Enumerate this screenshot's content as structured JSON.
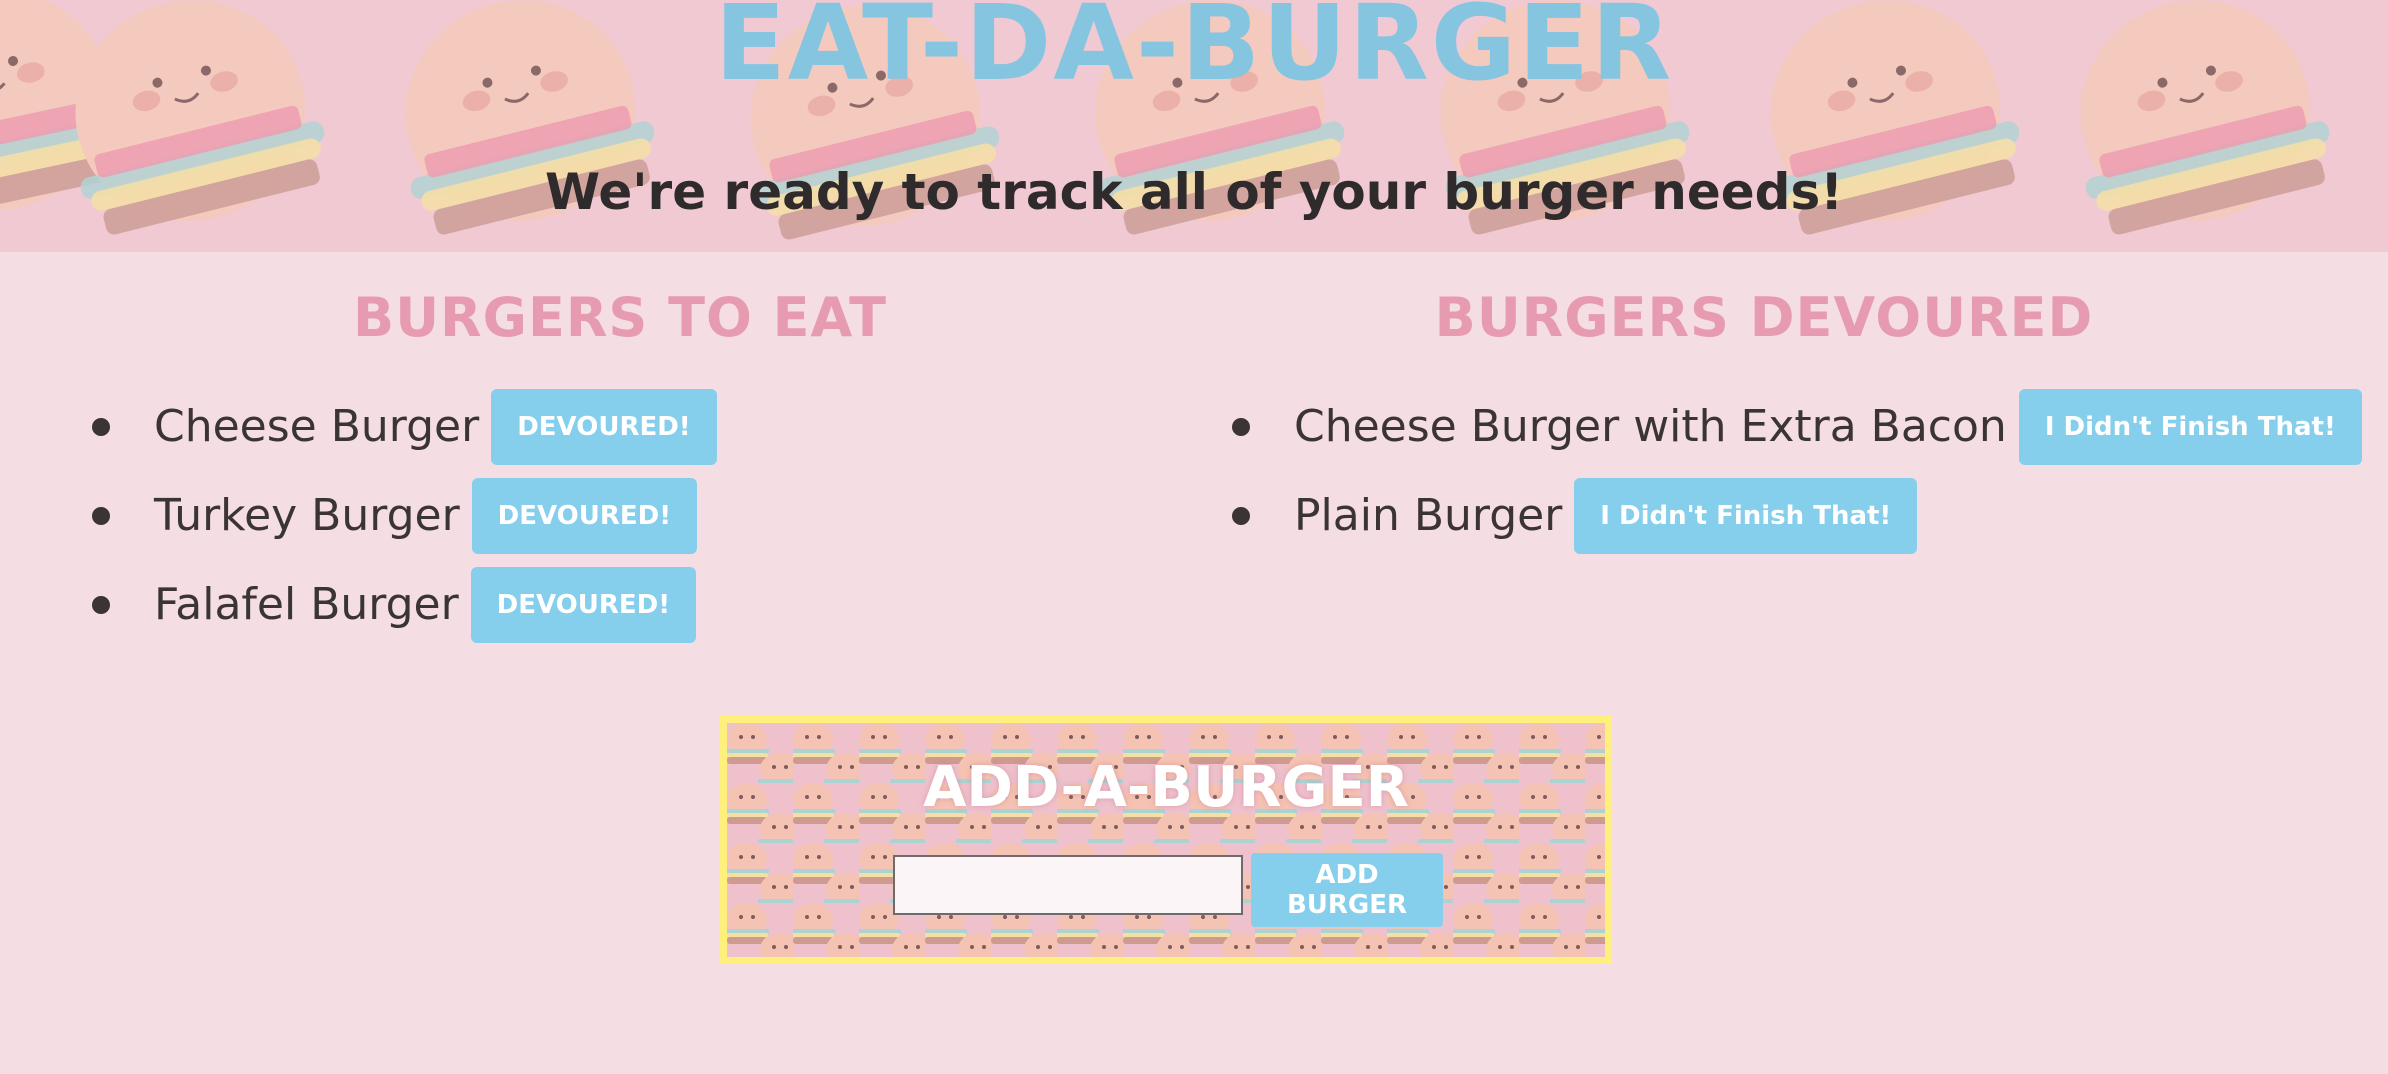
{
  "header": {
    "title": "EAT-DA-BURGER",
    "subtitle": "We're ready to track all of your burger needs!"
  },
  "to_eat": {
    "heading": "Burgers To Eat",
    "items": [
      {
        "name": "Cheese Burger",
        "button": "DEVOURED!"
      },
      {
        "name": "Turkey Burger",
        "button": "DEVOURED!"
      },
      {
        "name": "Falafel Burger",
        "button": "DEVOURED!"
      }
    ]
  },
  "devoured": {
    "heading": "Burgers Devoured",
    "items": [
      {
        "name": "Cheese Burger with Extra Bacon",
        "button": "I Didn't Finish That!"
      },
      {
        "name": "Plain Burger",
        "button": "I Didn't Finish That!"
      }
    ]
  },
  "add_form": {
    "title": "ADD-A-BURGER",
    "input_value": "",
    "button": "ADD BURGER"
  },
  "colors": {
    "background": "#f4dde3",
    "banner": "#f1c9d2",
    "title_blue": "#86c5e0",
    "heading_pink": "#e79bb0",
    "button_blue": "#85cfec",
    "panel_border": "#fff07e"
  }
}
